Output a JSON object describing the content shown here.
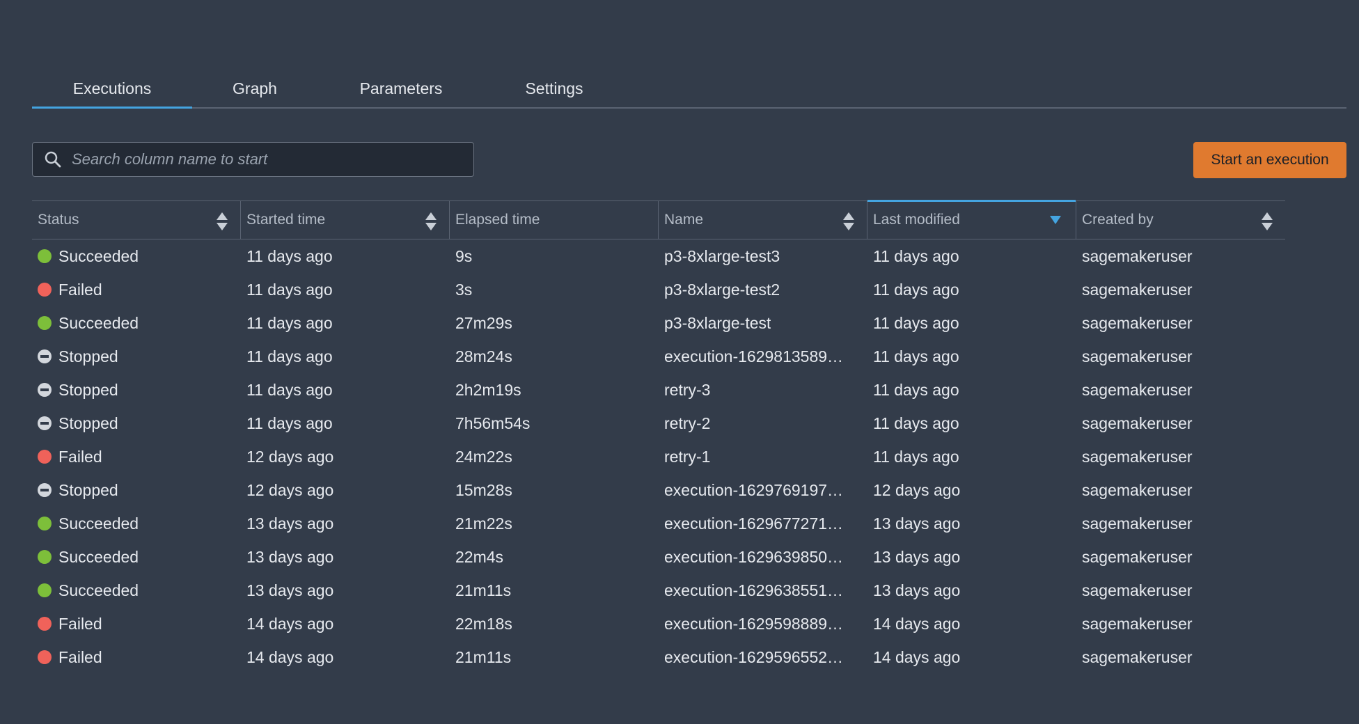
{
  "tabs": [
    {
      "label": "Executions",
      "active": true
    },
    {
      "label": "Graph",
      "active": false
    },
    {
      "label": "Parameters",
      "active": false
    },
    {
      "label": "Settings",
      "active": false
    }
  ],
  "search": {
    "placeholder": "Search column name to start",
    "icon": "search-icon"
  },
  "start_button_label": "Start an execution",
  "colors": {
    "background": "#333c4a",
    "accent": "#44a4e0",
    "primary_button": "#e07a2f",
    "succeeded": "#7dbf3a",
    "failed": "#f0625a",
    "stopped": "#d3d7dd"
  },
  "table": {
    "columns": [
      {
        "label": "Status",
        "sort": "both"
      },
      {
        "label": "Started time",
        "sort": "both"
      },
      {
        "label": "Elapsed time",
        "sort": "none"
      },
      {
        "label": "Name",
        "sort": "both"
      },
      {
        "label": "Last modified",
        "sort": "desc"
      },
      {
        "label": "Created by",
        "sort": "both"
      }
    ],
    "rows": [
      {
        "status": "Succeeded",
        "started": "11 days ago",
        "elapsed": "9s",
        "name": "p3-8xlarge-test3",
        "modified": "11 days ago",
        "created_by": "sagemakeruser"
      },
      {
        "status": "Failed",
        "started": "11 days ago",
        "elapsed": "3s",
        "name": "p3-8xlarge-test2",
        "modified": "11 days ago",
        "created_by": "sagemakeruser"
      },
      {
        "status": "Succeeded",
        "started": "11 days ago",
        "elapsed": "27m29s",
        "name": "p3-8xlarge-test",
        "modified": "11 days ago",
        "created_by": "sagemakeruser"
      },
      {
        "status": "Stopped",
        "started": "11 days ago",
        "elapsed": "28m24s",
        "name": "execution-1629813589…",
        "modified": "11 days ago",
        "created_by": "sagemakeruser"
      },
      {
        "status": "Stopped",
        "started": "11 days ago",
        "elapsed": "2h2m19s",
        "name": "retry-3",
        "modified": "11 days ago",
        "created_by": "sagemakeruser"
      },
      {
        "status": "Stopped",
        "started": "11 days ago",
        "elapsed": "7h56m54s",
        "name": "retry-2",
        "modified": "11 days ago",
        "created_by": "sagemakeruser"
      },
      {
        "status": "Failed",
        "started": "12 days ago",
        "elapsed": "24m22s",
        "name": "retry-1",
        "modified": "11 days ago",
        "created_by": "sagemakeruser"
      },
      {
        "status": "Stopped",
        "started": "12 days ago",
        "elapsed": "15m28s",
        "name": "execution-1629769197…",
        "modified": "12 days ago",
        "created_by": "sagemakeruser"
      },
      {
        "status": "Succeeded",
        "started": "13 days ago",
        "elapsed": "21m22s",
        "name": "execution-1629677271…",
        "modified": "13 days ago",
        "created_by": "sagemakeruser"
      },
      {
        "status": "Succeeded",
        "started": "13 days ago",
        "elapsed": "22m4s",
        "name": "execution-1629639850…",
        "modified": "13 days ago",
        "created_by": "sagemakeruser"
      },
      {
        "status": "Succeeded",
        "started": "13 days ago",
        "elapsed": "21m11s",
        "name": "execution-1629638551…",
        "modified": "13 days ago",
        "created_by": "sagemakeruser"
      },
      {
        "status": "Failed",
        "started": "14 days ago",
        "elapsed": "22m18s",
        "name": "execution-1629598889…",
        "modified": "14 days ago",
        "created_by": "sagemakeruser"
      },
      {
        "status": "Failed",
        "started": "14 days ago",
        "elapsed": "21m11s",
        "name": "execution-1629596552…",
        "modified": "14 days ago",
        "created_by": "sagemakeruser"
      }
    ]
  }
}
